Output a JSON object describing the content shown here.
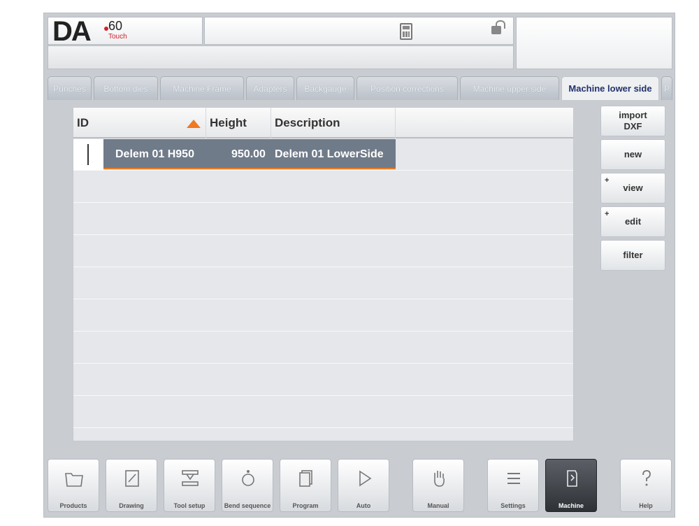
{
  "logo": {
    "brand": "DA",
    "model": "60",
    "edition": "Touch"
  },
  "header": {
    "calculator_icon": "calculator-icon",
    "lock_icon": "unlock-icon"
  },
  "tabs": [
    {
      "label": "Punches"
    },
    {
      "label": "Bottom dies"
    },
    {
      "label": "Machine Frame"
    },
    {
      "label": "Adapters"
    },
    {
      "label": "Backgauge"
    },
    {
      "label": "Position corrections"
    },
    {
      "label": "Machine upper side"
    },
    {
      "label": "Machine lower side",
      "active": true
    },
    {
      "label": "P"
    }
  ],
  "table": {
    "columns": [
      "ID",
      "Height",
      "Description"
    ],
    "rows": [
      {
        "id": "Delem 01 H950",
        "height": "950.00",
        "description": "Delem 01 LowerSide"
      }
    ]
  },
  "side_buttons": {
    "import_dxf": "import\nDXF",
    "new": "new",
    "view": "view",
    "edit": "edit",
    "filter": "filter",
    "plus": "+"
  },
  "nav": [
    {
      "label": "Products",
      "icon": "folder-icon"
    },
    {
      "label": "Drawing",
      "icon": "drawing-icon"
    },
    {
      "label": "Tool setup",
      "icon": "tool-setup-icon"
    },
    {
      "label": "Bend sequence",
      "icon": "bend-sequence-icon"
    },
    {
      "label": "Program",
      "icon": "program-icon"
    },
    {
      "label": "Auto",
      "icon": "play-icon"
    },
    {
      "label": "Manual",
      "icon": "hand-icon"
    },
    {
      "label": "Settings",
      "icon": "settings-icon"
    },
    {
      "label": "Machine",
      "icon": "machine-icon",
      "active": true
    },
    {
      "label": "Help",
      "icon": "help-icon"
    }
  ],
  "colors": {
    "accent": "#ee7a22",
    "selection": "#6f7b89",
    "active_tab_text": "#22326b"
  }
}
